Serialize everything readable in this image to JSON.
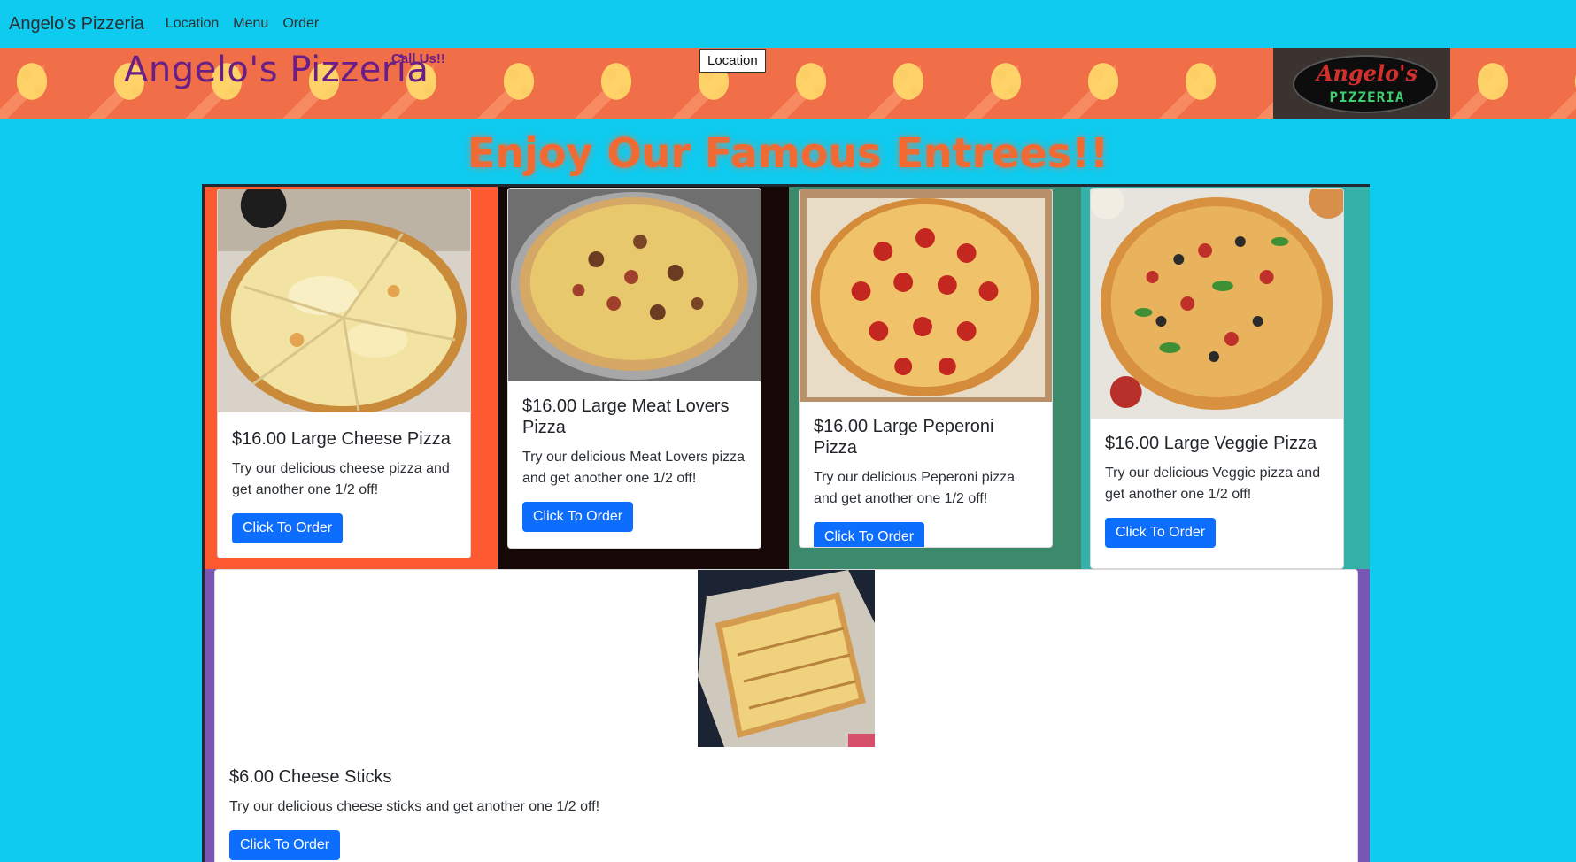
{
  "navbar": {
    "brand": "Angelo's Pizzeria",
    "links": [
      "Location",
      "Menu",
      "Order"
    ]
  },
  "banner": {
    "title": "Angelo's Pizzeria",
    "call_us": "Call Us!!",
    "location_button": "Location",
    "logo": {
      "name": "Angelo's",
      "sub": "PIZZERIA"
    }
  },
  "heading": "Enjoy Our Famous Entrees!!",
  "menu": [
    {
      "title": "$16.00 Large Cheese Pizza",
      "text": "Try our delicious cheese pizza and get another one 1/2 off!",
      "button": "Click To Order"
    },
    {
      "title": "$16.00 Large Meat Lovers Pizza",
      "text": "Try our delicious Meat Lovers pizza and get another one 1/2 off!",
      "button": "Click To Order"
    },
    {
      "title": "$16.00 Large Peperoni Pizza",
      "text": "Try our delicious Peperoni pizza and get another one 1/2 off!",
      "button": "Click To Order"
    },
    {
      "title": "$16.00 Large Veggie Pizza",
      "text": "Try our delicious Veggie pizza and get another one 1/2 off!",
      "button": "Click To Order"
    },
    {
      "title": "$6.00 Cheese Sticks",
      "text": "Try our delicious cheese sticks and get another one 1/2 off!",
      "button": "Click To Order"
    }
  ],
  "colors": {
    "page_bg": "#0ecbef",
    "heading": "#f06a34",
    "button": "#0d6efd",
    "cell_1": "#fd5a32",
    "cell_2": "#150807",
    "cell_3": "#3d896c",
    "cell_4": "#34b2a9",
    "cell_wide": "#7a56b5"
  }
}
